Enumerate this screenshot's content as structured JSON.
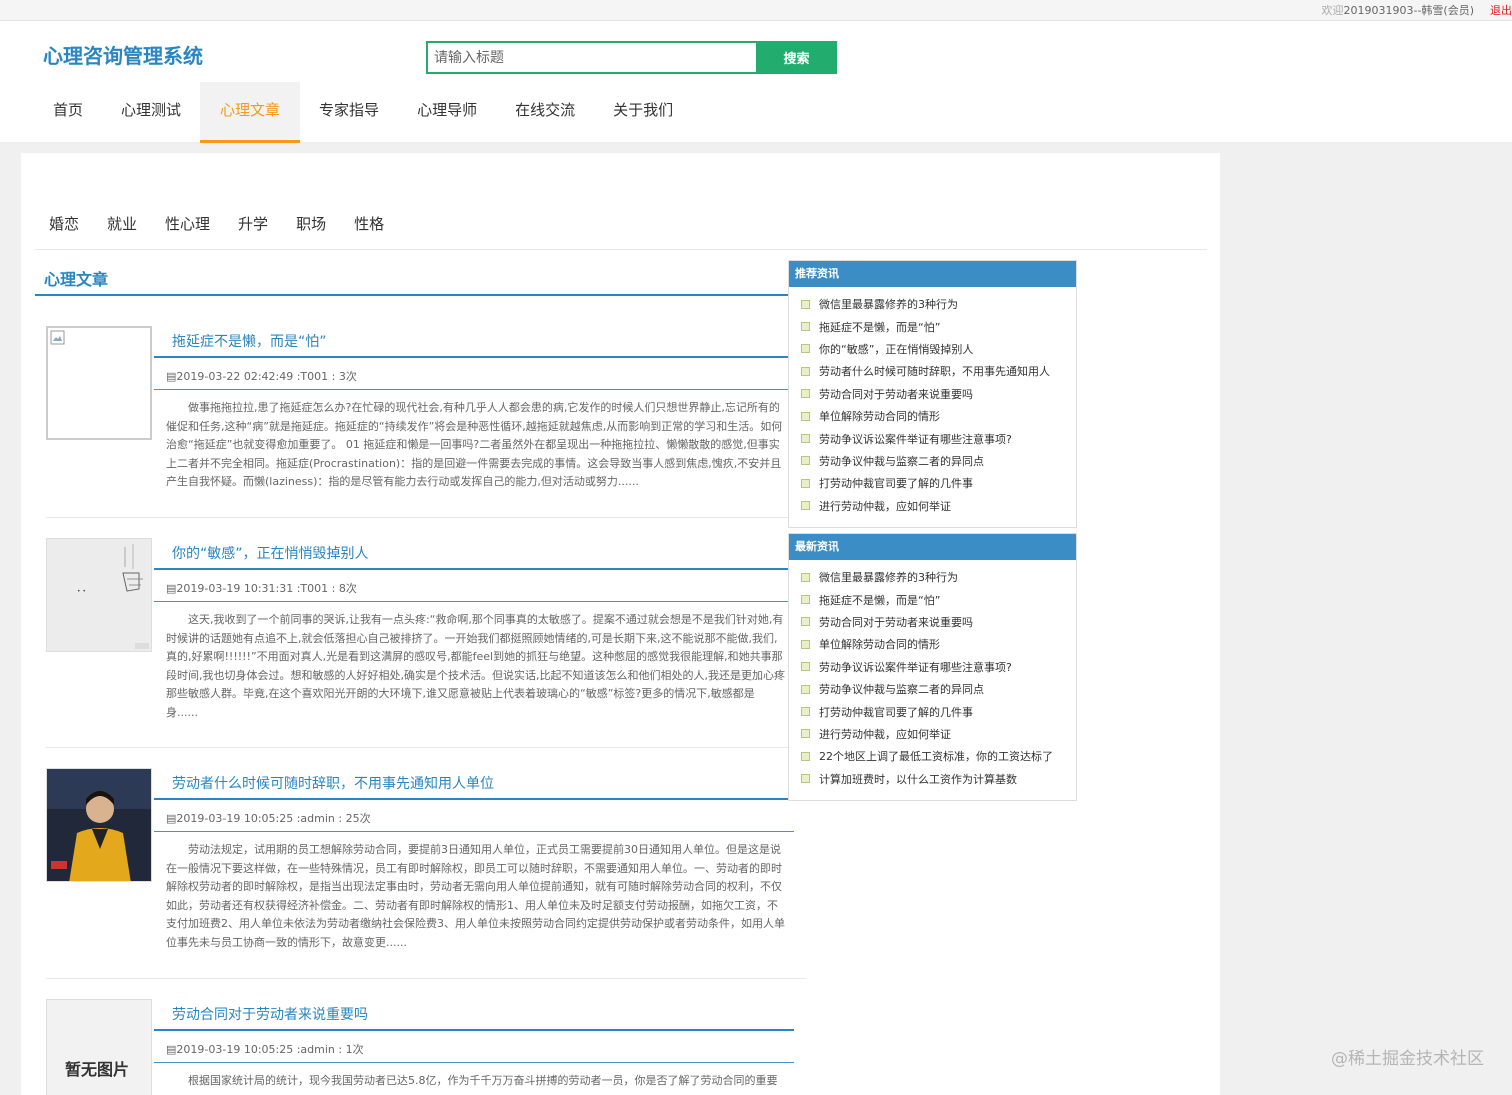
{
  "topbar": {
    "welcome_prefix": "欢迎",
    "user": "2019031903--韩雪(会员)",
    "logout": "退出"
  },
  "header": {
    "logo": "心理咨询管理系统",
    "search_placeholder": "请输入标题",
    "search_button": "搜索",
    "nav": [
      "首页",
      "心理测试",
      "心理文章",
      "专家指导",
      "心理导师",
      "在线交流",
      "关于我们"
    ],
    "active_nav": "心理文章"
  },
  "categories": [
    "婚恋",
    "就业",
    "性心理",
    "升学",
    "职场",
    "性格"
  ],
  "section_title": "心理文章",
  "articles": [
    {
      "title": "拖延症不是懒，而是“怕”",
      "meta": "2019-03-22 02:42:49 :T001 : 3次",
      "body": "做事拖拖拉拉,患了拖延症怎么办?在忙碌的现代社会,有种几乎人人都会患的病,它发作的时候人们只想世界静止,忘记所有的催促和任务,这种“病”就是拖延症。拖延症的“持续发作”将会是种恶性循环,越拖延就越焦虑,从而影响到正常的学习和生活。如何治愈“拖延症”也就变得愈加重要了。 01 拖延症和懒是一回事吗?二者虽然外在都呈现出一种拖拖拉拉、懒懒散散的感觉,但事实上二者并不完全相同。拖延症(Procrastination)：指的是回避一件需要去完成的事情。这会导致当事人感到焦虑,愧疚,不安并且产生自我怀疑。而懒(laziness)：指的是尽管有能力去行动或发挥自己的能力,但对活动或努力......",
      "thumb": "broken-image-icon"
    },
    {
      "title": "你的“敏感”，正在悄悄毁掉别人",
      "meta": "2019-03-19 10:31:31 :T001 : 8次",
      "body": "这天,我收到了一个前同事的哭诉,让我有一点头疼:“救命啊,那个同事真的太敏感了。提案不通过就会想是不是我们针对她,有时候讲的话题她有点追不上,就会低落担心自己被排挤了。一开始我们都挺照顾她情绪的,可是长期下来,这不能说那不能做,我们,真的,好累啊!!!!!!”不用面对真人,光是看到这满屏的感叹号,都能feel到她的抓狂与绝望。这种憋屈的感觉我很能理解,和她共事那段时间,我也切身体会过。想和敏感的人好好相处,确实是个技术活。但说实话,比起不知道该怎么和他们相处的人,我还是更加心疼那些敏感人群。毕竟,在这个喜欢阳光开朗的大环境下,谁又愿意被贴上代表着玻璃心的“敏感”标签?更多的情况下,敏感都是身......",
      "thumb": "sketch-image"
    },
    {
      "title": "劳动者什么时候可随时辞职，不用事先通知用人单位",
      "meta": "2019-03-19 10:05:25 :admin : 25次",
      "body": "劳动法规定，试用期的员工想解除劳动合同，要提前3日通知用人单位，正式员工需要提前30日通知用人单位。但是这是说在一般情况下要这样做，在一些特殊情况，员工有即时解除权，即员工可以随时辞职，不需要通知用人单位。一、劳动者的即时解除权劳动者的即时解除权，是指当出现法定事由时，劳动者无需向用人单位提前通知，就有可随时解除劳动合同的权利，不仅如此，劳动者还有权获得经济补偿金。二、劳动者有即时解除权的情形1、用人单位未及时足额支付劳动报酬，如拖欠工资，不支付加班费2、用人单位未依法为劳动者缴纳社会保险费3、用人单位未按照劳动合同约定提供劳动保护或者劳动条件，如用人单位事先未与员工协商一致的情形下，故意变更......",
      "thumb": "news-anchor-image"
    },
    {
      "title": "劳动合同对于劳动者来说重要吗",
      "meta": "2019-03-19 10:05:25 :admin : 1次",
      "body": "根据国家统计局的统计，现今我国劳动者已达5.8亿，作为千千万万奋斗拼搏的劳动者一员，你是否了解了劳动合同的重要",
      "thumb": "no-image-placeholder",
      "thumb_text": "暂无图片"
    }
  ],
  "sidebar": {
    "recommended": {
      "title": "推荐资讯",
      "items": [
        "微信里最暴露修养的3种行为",
        "拖延症不是懒，而是“怕”",
        "你的“敏感”，正在悄悄毁掉别人",
        "劳动者什么时候可随时辞职，不用事先通知用人",
        "劳动合同对于劳动者来说重要吗",
        "单位解除劳动合同的情形",
        "劳动争议诉讼案件举证有哪些注意事项?",
        "劳动争议仲裁与监察二者的异同点",
        "打劳动仲裁官司要了解的几件事",
        "进行劳动仲裁，应如何举证"
      ]
    },
    "latest": {
      "title": "最新资讯",
      "items": [
        "微信里最暴露修养的3种行为",
        "拖延症不是懒，而是“怕”",
        "劳动合同对于劳动者来说重要吗",
        "单位解除劳动合同的情形",
        "劳动争议诉讼案件举证有哪些注意事项?",
        "劳动争议仲裁与监察二者的异同点",
        "打劳动仲裁官司要了解的几件事",
        "进行劳动仲裁，应如何举证",
        "22个地区上调了最低工资标准，你的工资达标了",
        "计算加班费时，以什么工资作为计算基数"
      ]
    }
  },
  "watermark": "@稀土掘金技术社区",
  "colors": {
    "primary": "#2a86c0",
    "accent": "#f39a1e",
    "search_button": "#22ad6e",
    "sidebar_head": "#3a8dc5"
  }
}
